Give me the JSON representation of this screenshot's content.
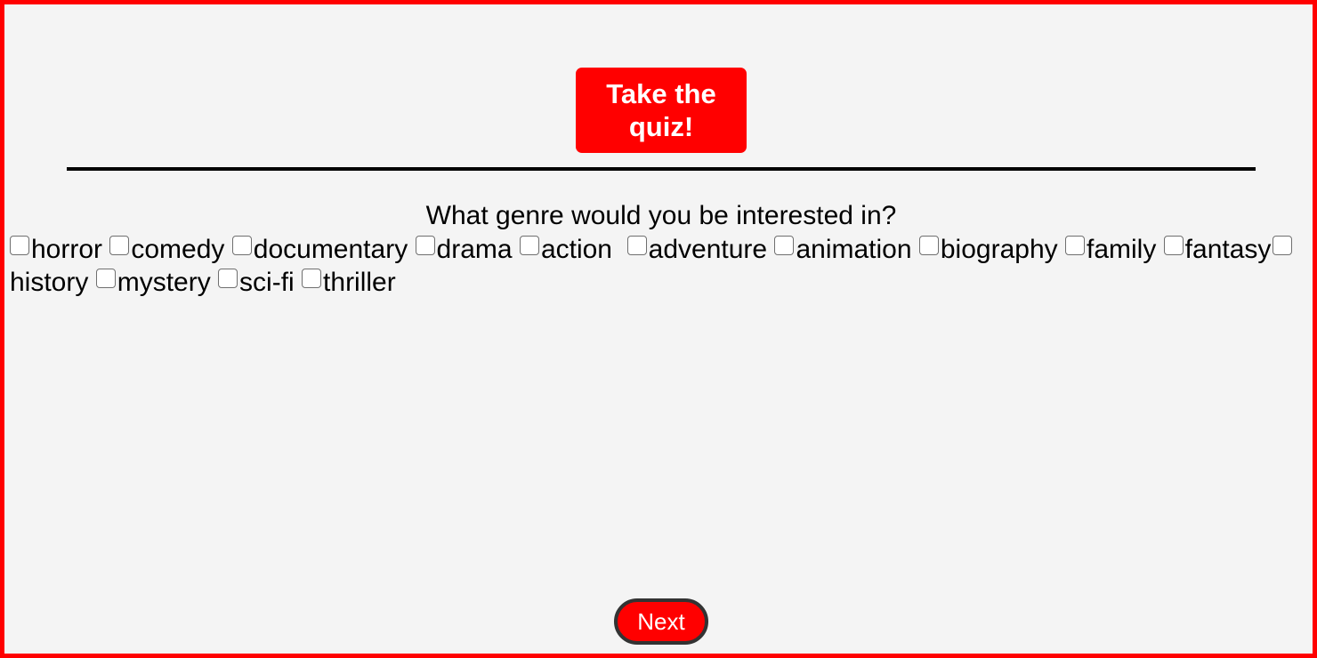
{
  "quiz": {
    "title": "Take the quiz!",
    "question": "What genre would you be interested in?",
    "genres": [
      {
        "label": "horror",
        "checked": false
      },
      {
        "label": "comedy",
        "checked": false
      },
      {
        "label": "documentary",
        "checked": false
      },
      {
        "label": "drama",
        "checked": false
      },
      {
        "label": "action ",
        "checked": false
      },
      {
        "label": "adventure",
        "checked": false
      },
      {
        "label": "animation",
        "checked": false
      },
      {
        "label": "biography",
        "checked": false
      },
      {
        "label": "family",
        "checked": false
      },
      {
        "label": "fantasy",
        "checked": false
      },
      {
        "label": "history",
        "checked": false
      },
      {
        "label": "mystery",
        "checked": false
      },
      {
        "label": "sci-fi",
        "checked": false
      },
      {
        "label": "thriller",
        "checked": false
      }
    ],
    "next_label": "Next"
  },
  "colors": {
    "accent": "#ff0000",
    "background": "#f4f4f4",
    "text": "#000000",
    "button_border": "#333333"
  }
}
